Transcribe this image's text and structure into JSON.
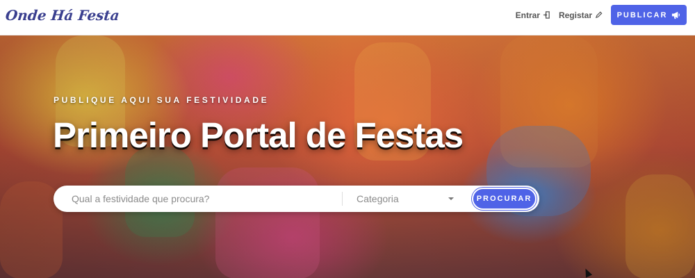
{
  "brand": {
    "logo_text": "Onde Há Festa"
  },
  "nav": {
    "login_label": "Entrar",
    "register_label": "Registar",
    "publish_label": "PUBLICAR"
  },
  "hero": {
    "kicker": "PUBLIQUE AQUI SUA FESTIVIDADE",
    "headline": "Primeiro Portal de Festas"
  },
  "search": {
    "placeholder": "Qual a festividade que procura?",
    "value": "",
    "category_label": "Categoria",
    "button_label": "PROCURAR"
  },
  "colors": {
    "accent": "#4f63e7",
    "logo": "#3a3f8f"
  },
  "icons": {
    "login": "login-icon",
    "register": "pencil-icon",
    "publish": "megaphone-icon",
    "category": "chevron-down-icon"
  }
}
